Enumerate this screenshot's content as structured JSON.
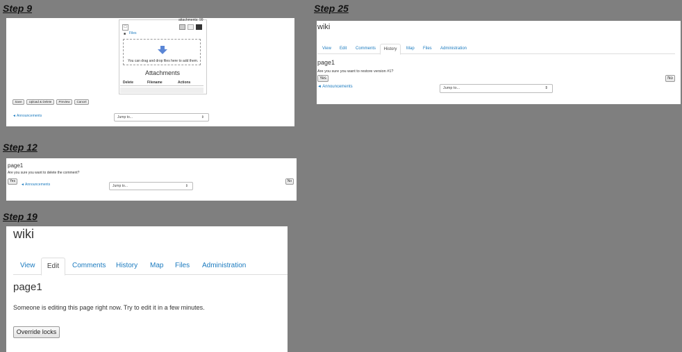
{
  "steps": {
    "s9": {
      "label": "Step 9",
      "attachments_count": "attachments: 99",
      "files_link": "Files",
      "dropzone_text": "You can drag and drop files here to add them.",
      "attachments_title": "Attachments",
      "columns": [
        "Delete",
        "Filename",
        "Actions"
      ],
      "buttons": [
        "Save",
        "Upload & Delete",
        "Preview",
        "Cancel"
      ],
      "announcements_link": "◄ Announcements",
      "jump_to": "Jump to..."
    },
    "s12": {
      "label": "Step 12",
      "title": "page1",
      "question": "Are you sure you want to delete the comment?",
      "yes": "Yes",
      "no": "No",
      "announcements_link": "◄ Announcements",
      "jump_to": "Jump to..."
    },
    "s19": {
      "label": "Step 19",
      "heading": "wiki",
      "tabs": [
        "View",
        "Edit",
        "Comments",
        "History",
        "Map",
        "Files",
        "Administration"
      ],
      "active_tab": "Edit",
      "page_title": "page1",
      "message": "Someone is editing this page right now. Try to edit it in a few minutes.",
      "override_button": "Override locks"
    },
    "s25": {
      "label": "Step 25",
      "heading": "wiki",
      "tabs": [
        "View",
        "Edit",
        "Comments",
        "History",
        "Map",
        "Files",
        "Administration"
      ],
      "active_tab": "History",
      "page_title": "page1",
      "question": "Are you sure you want to restore version #1?",
      "yes": "Yes",
      "no": "No",
      "announcements_link": "◄ Announcements",
      "jump_to": "Jump to..."
    }
  },
  "colors": {
    "background": "#7f7f7f",
    "link": "#1a7abf",
    "arrow": "#5a86d6"
  }
}
